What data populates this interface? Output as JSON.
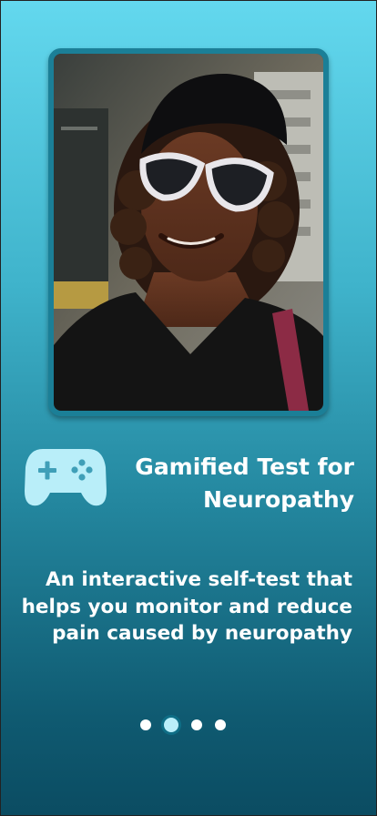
{
  "hero": {
    "image": "photo-woman-sunglasses-cap"
  },
  "feature": {
    "icon": "gamepad-icon",
    "title": "Gamified Test for Neuropathy"
  },
  "description": "An interactive self-test that helps you monitor and reduce pain caused by neuropathy",
  "pager": {
    "count": 4,
    "active_index": 1
  },
  "colors": {
    "background_top": "#63d8ee",
    "background_bottom": "#0b4c62",
    "frame_border": "#1b7f97",
    "icon": "#b9eef9",
    "text": "#ffffff"
  }
}
